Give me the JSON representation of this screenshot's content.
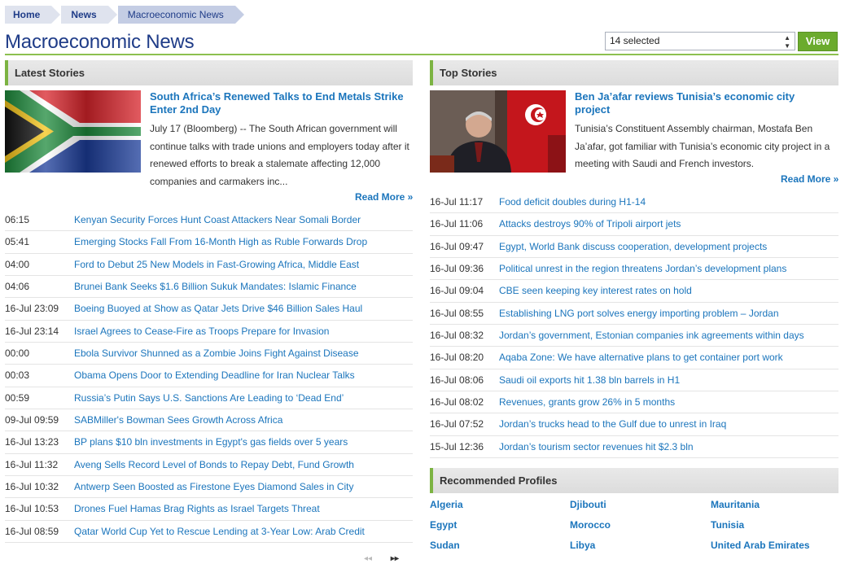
{
  "breadcrumb": [
    "Home",
    "News",
    "Macroeconomic News"
  ],
  "page_title": "Macroeconomic News",
  "filter": {
    "selected": "14 selected"
  },
  "view_button": "View",
  "latest": {
    "header": "Latest Stories",
    "featured": {
      "title": "South Africa’s Renewed Talks to End Metals Strike Enter 2nd Day",
      "body": "July 17 (Bloomberg) -- The South African government will continue talks with trade unions and employers today after it renewed efforts to break a stalemate affecting 12,000 companies and carmakers inc...",
      "image": "south-africa-flag",
      "read_more": "Read More »"
    },
    "items": [
      {
        "time": "06:15",
        "title": "Kenyan Security Forces Hunt Coast Attackers Near Somali Border"
      },
      {
        "time": "05:41",
        "title": "Emerging Stocks Fall From 16-Month High as Ruble Forwards Drop"
      },
      {
        "time": "04:00",
        "title": "Ford to Debut 25 New Models in Fast-Growing Africa, Middle East"
      },
      {
        "time": "04:06",
        "title": "Brunei Bank Seeks $1.6 Billion Sukuk Mandates: Islamic Finance"
      },
      {
        "time": "16-Jul 23:09",
        "title": "Boeing Buoyed at Show as Qatar Jets Drive $46 Billion Sales Haul"
      },
      {
        "time": "16-Jul 23:14",
        "title": "Israel Agrees to Cease-Fire as Troops Prepare for Invasion"
      },
      {
        "time": "00:00",
        "title": "Ebola Survivor Shunned as a Zombie Joins Fight Against Disease"
      },
      {
        "time": "00:03",
        "title": "Obama Opens Door to Extending Deadline for Iran Nuclear Talks"
      },
      {
        "time": "00:59",
        "title": "Russia’s Putin Says U.S. Sanctions Are Leading to ‘Dead End’"
      },
      {
        "time": "09-Jul 09:59",
        "title": "SABMiller's Bowman Sees Growth Across Africa"
      },
      {
        "time": "16-Jul 13:23",
        "title": "BP plans $10 bln investments in Egypt's gas fields over 5 years"
      },
      {
        "time": "16-Jul 11:32",
        "title": "Aveng Sells Record Level of Bonds to Repay Debt, Fund Growth"
      },
      {
        "time": "16-Jul 10:32",
        "title": "Antwerp Seen Boosted as Firestone Eyes Diamond Sales in City"
      },
      {
        "time": "16-Jul 10:53",
        "title": "Drones Fuel Hamas Brag Rights as Israel Targets Threat"
      },
      {
        "time": "16-Jul 08:59",
        "title": "Qatar World Cup Yet to Rescue Lending at 3-Year Low: Arab Credit"
      }
    ],
    "pager": {
      "prev": "◂◂",
      "next": "▸▸"
    }
  },
  "top": {
    "header": "Top Stories",
    "featured": {
      "title": "Ben Ja’afar reviews Tunisia’s economic city project",
      "body": "Tunisia’s Constituent Assembly chairman, Mostafa Ben Ja’afar, got familiar with Tunisia’s economic city project in a meeting with Saudi and French investors.",
      "image": "tunisia-official-photo",
      "read_more": "Read More »"
    },
    "items": [
      {
        "time": "16-Jul 11:17",
        "title": "Food deficit doubles during H1-14"
      },
      {
        "time": "16-Jul 11:06",
        "title": "Attacks destroys 90% of Tripoli airport jets"
      },
      {
        "time": "16-Jul 09:47",
        "title": "Egypt, World Bank discuss cooperation, development projects"
      },
      {
        "time": "16-Jul 09:36",
        "title": "Political unrest in the region threatens Jordan’s development plans"
      },
      {
        "time": "16-Jul 09:04",
        "title": "CBE seen keeping key interest rates on hold"
      },
      {
        "time": "16-Jul 08:55",
        "title": "Establishing LNG port solves energy importing problem – Jordan"
      },
      {
        "time": "16-Jul 08:32",
        "title": "Jordan’s government, Estonian companies ink agreements within days"
      },
      {
        "time": "16-Jul 08:20",
        "title": "Aqaba Zone: We have alternative plans to get container port work"
      },
      {
        "time": "16-Jul 08:06",
        "title": "Saudi oil exports hit 1.38 bln barrels in H1"
      },
      {
        "time": "16-Jul 08:02",
        "title": "Revenues, grants grow 26% in 5 months"
      },
      {
        "time": "16-Jul 07:52",
        "title": "Jordan’s trucks head to the Gulf due to unrest in Iraq"
      },
      {
        "time": "15-Jul 12:36",
        "title": "Jordan’s tourism sector revenues hit $2.3 bln"
      }
    ]
  },
  "profiles": {
    "header": "Recommended Profiles",
    "items": [
      "Algeria",
      "Djibouti",
      "Mauritania",
      "Egypt",
      "Morocco",
      "Tunisia",
      "Sudan",
      "Libya",
      "United Arab Emirates"
    ]
  },
  "colors": {
    "link": "#1b75bc",
    "title": "#1f3c88",
    "accent": "#7cb342",
    "button": "#6bab2d"
  }
}
